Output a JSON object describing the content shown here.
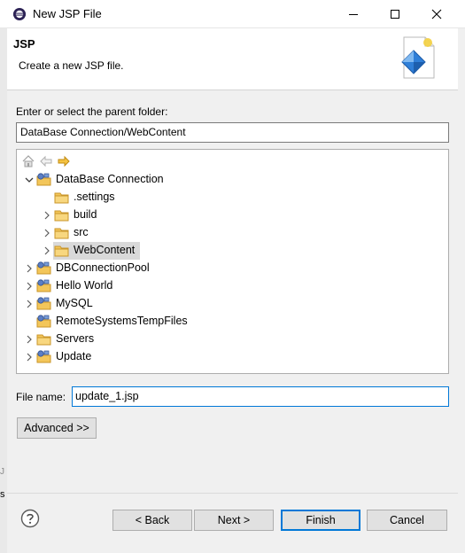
{
  "window": {
    "title": "New JSP File"
  },
  "banner": {
    "heading": "JSP",
    "description": "Create a new JSP file."
  },
  "parent_folder": {
    "label": "Enter or select the parent folder:",
    "value": "DataBase Connection/WebContent"
  },
  "tree": {
    "items": [
      {
        "label": "DataBase Connection",
        "level": 0,
        "expanded": true,
        "icon": "project-icon"
      },
      {
        "label": ".settings",
        "level": 1,
        "expanded": null,
        "icon": "folder-icon"
      },
      {
        "label": "build",
        "level": 1,
        "expanded": false,
        "icon": "folder-icon"
      },
      {
        "label": "src",
        "level": 1,
        "expanded": false,
        "icon": "folder-icon"
      },
      {
        "label": "WebContent",
        "level": 1,
        "expanded": false,
        "icon": "folder-icon",
        "selected": true
      },
      {
        "label": "DBConnectionPool",
        "level": 0,
        "expanded": false,
        "icon": "project-icon"
      },
      {
        "label": "Hello World",
        "level": 0,
        "expanded": false,
        "icon": "project-icon"
      },
      {
        "label": "MySQL",
        "level": 0,
        "expanded": false,
        "icon": "project-icon"
      },
      {
        "label": "RemoteSystemsTempFiles",
        "level": 0,
        "expanded": null,
        "icon": "project-icon"
      },
      {
        "label": "Servers",
        "level": 0,
        "expanded": false,
        "icon": "folder-icon"
      },
      {
        "label": "Update",
        "level": 0,
        "expanded": false,
        "icon": "project-icon"
      }
    ]
  },
  "file_name": {
    "label": "File name:",
    "value": "update_1.jsp"
  },
  "buttons": {
    "advanced": "Advanced >>",
    "back": "< Back",
    "next": "Next >",
    "finish": "Finish",
    "cancel": "Cancel"
  },
  "background_fragments": {
    "frag1": "J",
    "frag2": "s"
  },
  "colors": {
    "accent": "#0078d7",
    "selection": "#d9d9d9",
    "folder": "#e8b84a"
  }
}
